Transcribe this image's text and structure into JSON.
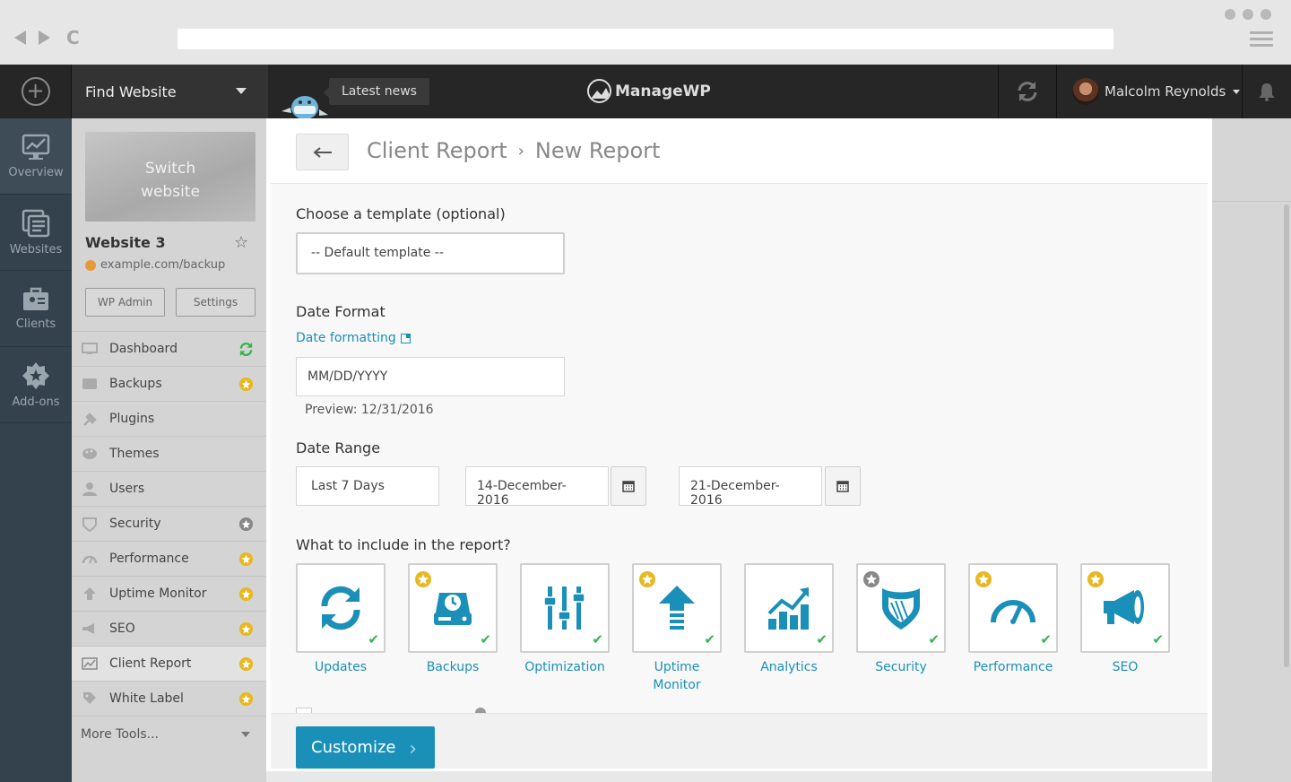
{
  "browser": {
    "address": ""
  },
  "topbar": {
    "find_label": "Find Website",
    "news_label": "Latest news",
    "logo_text": "ManageWP",
    "user_name": "Malcolm Reynolds"
  },
  "rail": {
    "items": [
      {
        "label": "Overview",
        "icon": "overview-icon"
      },
      {
        "label": "Websites",
        "icon": "websites-icon"
      },
      {
        "label": "Clients",
        "icon": "clients-icon"
      },
      {
        "label": "Add-ons",
        "icon": "addons-icon"
      }
    ]
  },
  "site": {
    "switch_label": "Switch website",
    "name": "Website 3",
    "url": "example.com/backup",
    "wp_admin_label": "WP Admin",
    "settings_label": "Settings"
  },
  "menu": {
    "items": [
      {
        "label": "Dashboard",
        "badge": "sync"
      },
      {
        "label": "Backups",
        "badge": "gold"
      },
      {
        "label": "Plugins",
        "badge": ""
      },
      {
        "label": "Themes",
        "badge": ""
      },
      {
        "label": "Users",
        "badge": ""
      },
      {
        "label": "Security",
        "badge": "gray"
      },
      {
        "label": "Performance",
        "badge": "gold"
      },
      {
        "label": "Uptime Monitor",
        "badge": "gold"
      },
      {
        "label": "SEO",
        "badge": "gold"
      },
      {
        "label": "Client Report",
        "badge": "gold"
      },
      {
        "label": "White Label",
        "badge": "gold"
      }
    ],
    "more_label": "More Tools..."
  },
  "modal": {
    "breadcrumb": {
      "parent": "Client Report",
      "sep": "›",
      "current": "New Report"
    },
    "template_label": "Choose a template (optional)",
    "template_value": "-- Default template --",
    "date_format_label": "Date Format",
    "date_format_link": "Date formatting",
    "date_format_value": "MM/DD/YYYY",
    "preview": "Preview: 12/31/2016",
    "date_range_label": "Date Range",
    "range_preset": "Last 7 Days",
    "range_start": "14-December-2016",
    "range_end": "21-December-2016",
    "include_label": "What to include in the report?",
    "tiles": [
      {
        "label": "Updates",
        "badge": ""
      },
      {
        "label": "Backups",
        "badge": "gold"
      },
      {
        "label": "Optimization",
        "badge": ""
      },
      {
        "label": "Uptime Monitor",
        "badge": "gold"
      },
      {
        "label": "Analytics",
        "badge": ""
      },
      {
        "label": "Security",
        "badge": "gray"
      },
      {
        "label": "Performance",
        "badge": "gold"
      },
      {
        "label": "SEO",
        "badge": "gold"
      }
    ],
    "customize_label": "Customize"
  },
  "colors": {
    "accent": "#1a8fb8",
    "check": "#35b44a",
    "gold": "#e8b820",
    "rail": "#34424d"
  }
}
